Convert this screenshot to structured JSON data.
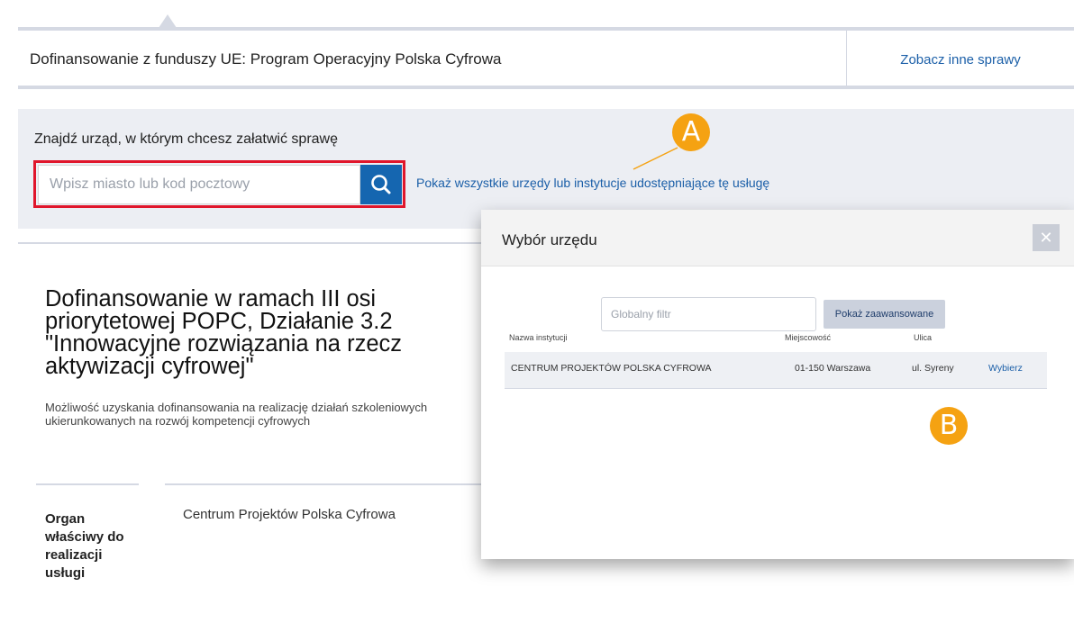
{
  "header": {
    "service_title": "Dofinansowanie z funduszy UE: Program Operacyjny Polska Cyfrowa",
    "other_cases_link": "Zobacz inne sprawy"
  },
  "search": {
    "heading": "Znajdź urząd, w którym chcesz załatwić sprawę",
    "placeholder": "Wpisz miasto lub kod pocztowy",
    "button_icon": "search-icon",
    "show_all_link": "Pokaż wszystkie urzędy lub instytucje udostępniające tę usługę"
  },
  "article": {
    "title": "Dofinansowanie w ramach III osi priorytetowej POPC, Działanie 3.2 \"Innowacyjne rozwiązania na rzecz aktywizacji cyfrowej\"",
    "description": "Możliwość uzyskania dofinansowania na realizację działań szkoleniowych ukierunkowanych na rozwój kompetencji cyfrowych",
    "org_label": "Organ właściwy do realizacji usługi",
    "org_value": "Centrum Projektów Polska Cyfrowa"
  },
  "modal": {
    "title": "Wybór urzędu",
    "close_icon": "close-icon",
    "filter_placeholder": "Globalny filtr",
    "advanced_button": "Pokaż zaawansowane",
    "columns": [
      "Nazwa instytucji",
      "Miejscowość",
      "Ulica"
    ],
    "rows": [
      {
        "name": "CENTRUM PROJEKTÓW POLSKA CYFROWA",
        "city": "01-150 Warszawa",
        "street": "ul. Syreny",
        "action": "Wybierz"
      }
    ]
  },
  "callouts": {
    "a": "A",
    "b": "B"
  },
  "colors": {
    "accent": "#1566b0",
    "link": "#1b5fa8",
    "highlight": "#e0162b",
    "callout": "#f5a212"
  }
}
